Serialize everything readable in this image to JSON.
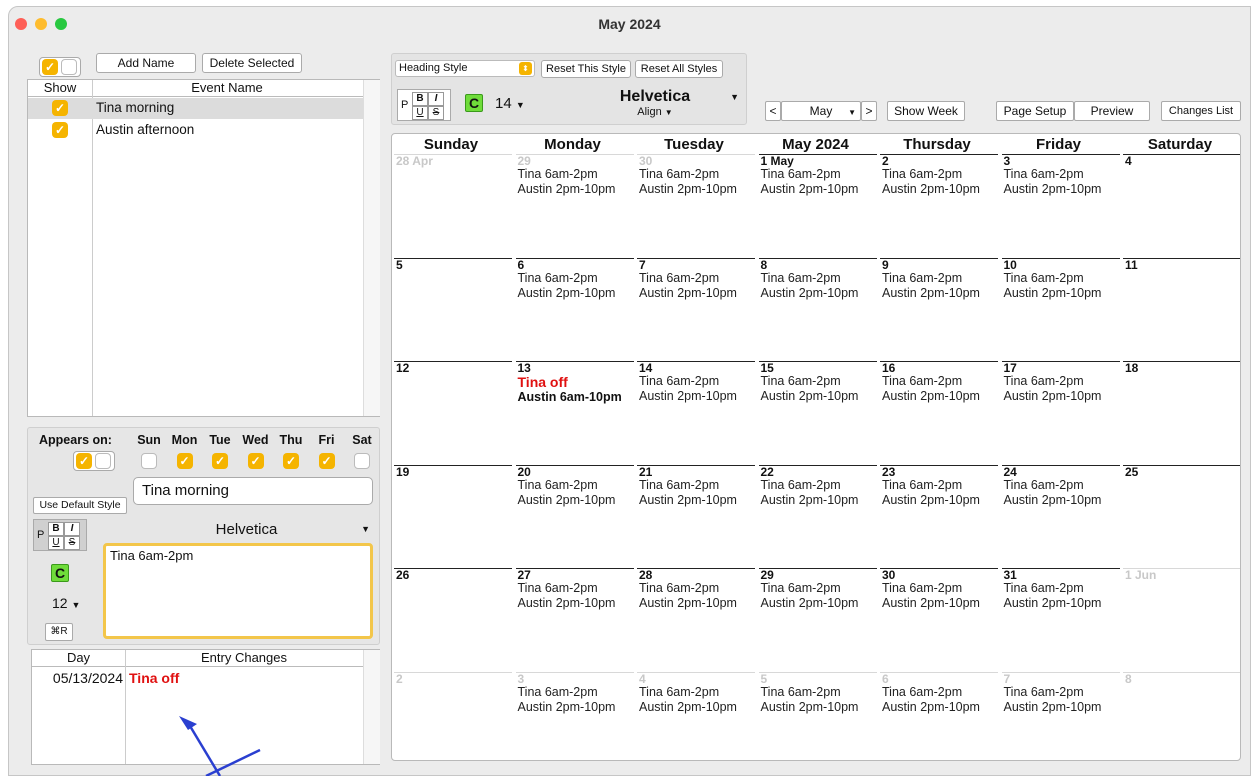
{
  "window": {
    "title": "May 2024"
  },
  "name_panel": {
    "add_name_label": "Add Name",
    "delete_selected_label": "Delete Selected",
    "col_show": "Show",
    "col_event_name": "Event Name",
    "events": [
      {
        "name": "Tina morning",
        "shown": true,
        "selected": true
      },
      {
        "name": "Austin afternoon",
        "shown": true,
        "selected": false
      }
    ]
  },
  "appears_on": {
    "label": "Appears on:",
    "days": [
      {
        "label": "Sun",
        "checked": false
      },
      {
        "label": "Mon",
        "checked": true
      },
      {
        "label": "Tue",
        "checked": true
      },
      {
        "label": "Wed",
        "checked": true
      },
      {
        "label": "Thu",
        "checked": true
      },
      {
        "label": "Fri",
        "checked": true
      },
      {
        "label": "Sat",
        "checked": false
      }
    ]
  },
  "editor": {
    "name_value": "Tina morning",
    "use_default_style_label": "Use Default Style",
    "font_name": "Helvetica",
    "text_value": "Tina 6am-2pm",
    "font_size": "12",
    "c_label": "C",
    "p_label": "P",
    "shortcut_label": "⌘R"
  },
  "changes": {
    "col_day": "Day",
    "col_entry_changes": "Entry Changes",
    "rows": [
      {
        "day": "05/13/2024",
        "entry": "Tina off"
      }
    ]
  },
  "style_panel": {
    "style_select": "Heading Style",
    "reset_this_label": "Reset This Style",
    "reset_all_label": "Reset All Styles",
    "p_label": "P",
    "c_label": "C",
    "font_size": "14",
    "font_name": "Helvetica",
    "align_label": "Align"
  },
  "toolbar": {
    "prev_label": "<",
    "month_value": "May",
    "next_label": ">",
    "show_week_label": "Show Week",
    "page_setup_label": "Page Setup",
    "preview_label": "Preview",
    "changes_list_label": "Changes List"
  },
  "calendar": {
    "headers": [
      "Sunday",
      "Monday",
      "Tuesday",
      "May 2024",
      "Thursday",
      "Friday",
      "Saturday"
    ],
    "weeks": [
      [
        {
          "day": "28 Apr",
          "dim": true,
          "events": []
        },
        {
          "day": "29",
          "dim": true,
          "events": [
            "Tina 6am-2pm",
            "Austin 2pm-10pm"
          ]
        },
        {
          "day": "30",
          "dim": true,
          "events": [
            "Tina 6am-2pm",
            "Austin 2pm-10pm"
          ]
        },
        {
          "day": "1 May",
          "dim": false,
          "events": [
            "Tina 6am-2pm",
            "Austin 2pm-10pm"
          ]
        },
        {
          "day": "2",
          "dim": false,
          "events": [
            "Tina 6am-2pm",
            "Austin 2pm-10pm"
          ]
        },
        {
          "day": "3",
          "dim": false,
          "events": [
            "Tina 6am-2pm",
            "Austin 2pm-10pm"
          ]
        },
        {
          "day": "4",
          "dim": false,
          "events": []
        }
      ],
      [
        {
          "day": "5",
          "dim": false,
          "events": []
        },
        {
          "day": "6",
          "dim": false,
          "events": [
            "Tina 6am-2pm",
            "Austin 2pm-10pm"
          ]
        },
        {
          "day": "7",
          "dim": false,
          "events": [
            "Tina 6am-2pm",
            "Austin 2pm-10pm"
          ]
        },
        {
          "day": "8",
          "dim": false,
          "events": [
            "Tina 6am-2pm",
            "Austin 2pm-10pm"
          ]
        },
        {
          "day": "9",
          "dim": false,
          "events": [
            "Tina 6am-2pm",
            "Austin 2pm-10pm"
          ]
        },
        {
          "day": "10",
          "dim": false,
          "events": [
            "Tina 6am-2pm",
            "Austin 2pm-10pm"
          ]
        },
        {
          "day": "11",
          "dim": false,
          "events": []
        }
      ],
      [
        {
          "day": "12",
          "dim": false,
          "events": []
        },
        {
          "day": "13",
          "dim": false,
          "events": [
            "Tina off",
            "Austin 6am-10pm"
          ],
          "styles": [
            "red",
            "bold"
          ]
        },
        {
          "day": "14",
          "dim": false,
          "events": [
            "Tina 6am-2pm",
            "Austin 2pm-10pm"
          ]
        },
        {
          "day": "15",
          "dim": false,
          "events": [
            "Tina 6am-2pm",
            "Austin 2pm-10pm"
          ]
        },
        {
          "day": "16",
          "dim": false,
          "events": [
            "Tina 6am-2pm",
            "Austin 2pm-10pm"
          ]
        },
        {
          "day": "17",
          "dim": false,
          "events": [
            "Tina 6am-2pm",
            "Austin 2pm-10pm"
          ]
        },
        {
          "day": "18",
          "dim": false,
          "events": []
        }
      ],
      [
        {
          "day": "19",
          "dim": false,
          "events": []
        },
        {
          "day": "20",
          "dim": false,
          "events": [
            "Tina 6am-2pm",
            "Austin 2pm-10pm"
          ]
        },
        {
          "day": "21",
          "dim": false,
          "events": [
            "Tina 6am-2pm",
            "Austin 2pm-10pm"
          ]
        },
        {
          "day": "22",
          "dim": false,
          "events": [
            "Tina 6am-2pm",
            "Austin 2pm-10pm"
          ]
        },
        {
          "day": "23",
          "dim": false,
          "events": [
            "Tina 6am-2pm",
            "Austin 2pm-10pm"
          ]
        },
        {
          "day": "24",
          "dim": false,
          "events": [
            "Tina 6am-2pm",
            "Austin 2pm-10pm"
          ]
        },
        {
          "day": "25",
          "dim": false,
          "events": []
        }
      ],
      [
        {
          "day": "26",
          "dim": false,
          "events": []
        },
        {
          "day": "27",
          "dim": false,
          "events": [
            "Tina 6am-2pm",
            "Austin 2pm-10pm"
          ]
        },
        {
          "day": "28",
          "dim": false,
          "events": [
            "Tina 6am-2pm",
            "Austin 2pm-10pm"
          ]
        },
        {
          "day": "29",
          "dim": false,
          "events": [
            "Tina 6am-2pm",
            "Austin 2pm-10pm"
          ]
        },
        {
          "day": "30",
          "dim": false,
          "events": [
            "Tina 6am-2pm",
            "Austin 2pm-10pm"
          ]
        },
        {
          "day": "31",
          "dim": false,
          "events": [
            "Tina 6am-2pm",
            "Austin 2pm-10pm"
          ]
        },
        {
          "day": "1 Jun",
          "dim": true,
          "events": []
        }
      ],
      [
        {
          "day": "2",
          "dim": true,
          "events": []
        },
        {
          "day": "3",
          "dim": true,
          "events": [
            "Tina 6am-2pm",
            "Austin 2pm-10pm"
          ]
        },
        {
          "day": "4",
          "dim": true,
          "events": [
            "Tina 6am-2pm",
            "Austin 2pm-10pm"
          ]
        },
        {
          "day": "5",
          "dim": true,
          "events": [
            "Tina 6am-2pm",
            "Austin 2pm-10pm"
          ]
        },
        {
          "day": "6",
          "dim": true,
          "events": [
            "Tina 6am-2pm",
            "Austin 2pm-10pm"
          ]
        },
        {
          "day": "7",
          "dim": true,
          "events": [
            "Tina 6am-2pm",
            "Austin 2pm-10pm"
          ]
        },
        {
          "day": "8",
          "dim": true,
          "events": []
        }
      ]
    ]
  },
  "colors": {
    "accent": "#f5b400",
    "highlight_red": "#e01010",
    "c_button": "#6fdc3a",
    "arrow": "#2a3fd0"
  },
  "annotation": {
    "icon": "arrow-icon"
  }
}
